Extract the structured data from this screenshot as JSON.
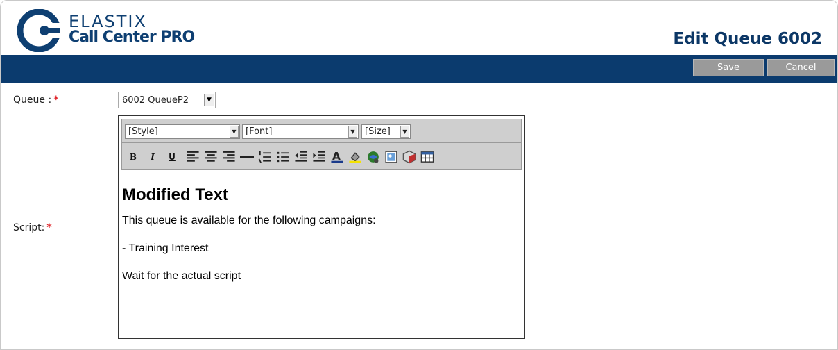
{
  "app": {
    "logo_line1": "ELASTIX",
    "logo_line2": "Call Center PRO"
  },
  "header": {
    "title": "Edit Queue 6002"
  },
  "toolbar": {
    "save_label": "Save",
    "cancel_label": "Cancel"
  },
  "form": {
    "queue_label": "Queue :",
    "script_label": "Script:",
    "required_mark": "*",
    "queue_value": "6002 QueueP2"
  },
  "editor": {
    "style_select": "[Style]",
    "font_select": "[Font]",
    "size_select": "[Size]",
    "tools": [
      {
        "name": "bold-button",
        "glyph": "B"
      },
      {
        "name": "italic-button",
        "glyph": "I"
      },
      {
        "name": "underline-button",
        "glyph": "U"
      }
    ],
    "heading": "Modified Text",
    "paragraphs": [
      "This queue is available for the following campaigns:",
      "- Training Interest",
      "Wait for the actual script"
    ]
  },
  "colors": {
    "brand": "#0b3b6e",
    "button_bg": "#9a9a9a",
    "required": "#e0242a"
  }
}
